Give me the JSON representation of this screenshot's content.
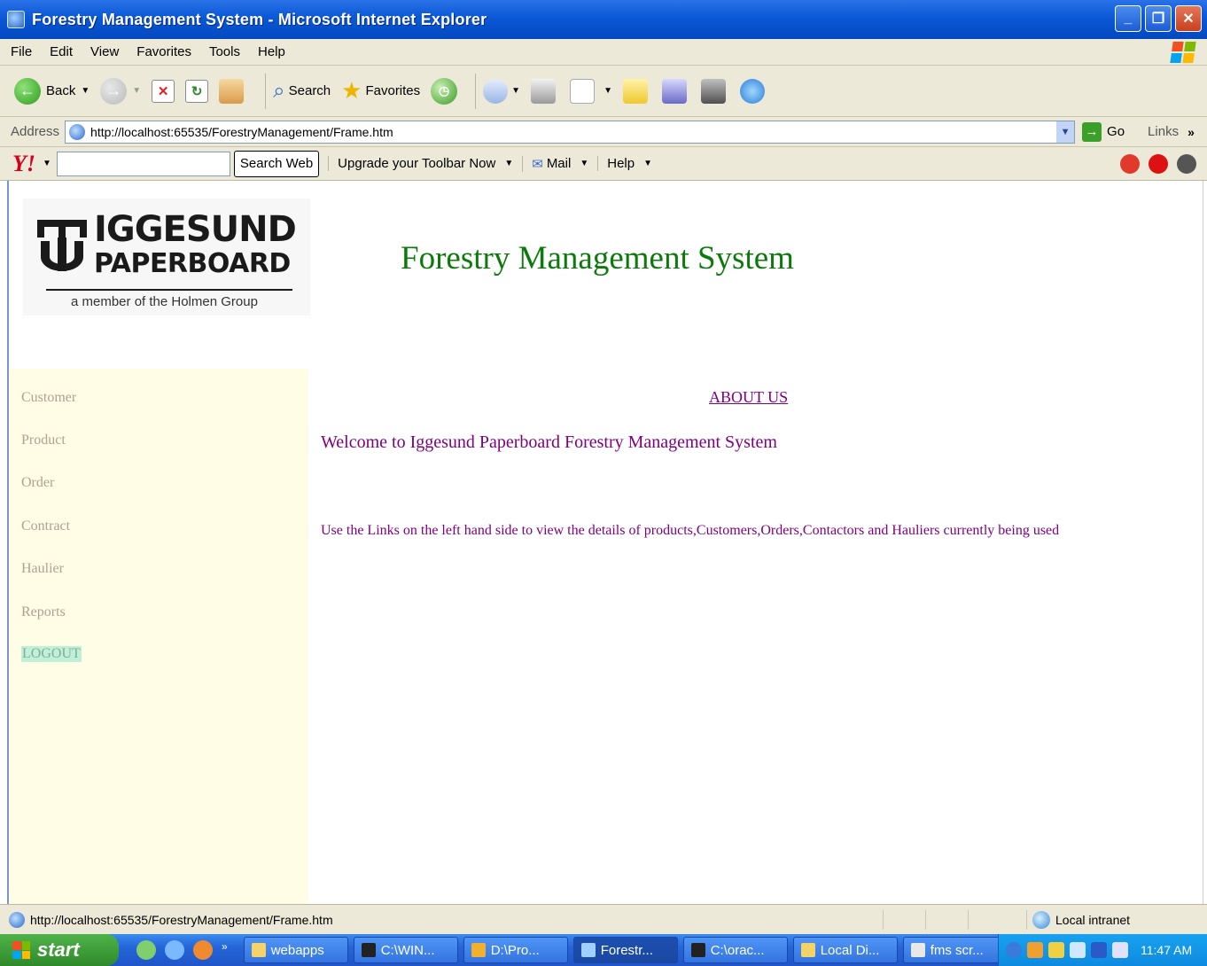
{
  "window": {
    "title": "Forestry Management System - Microsoft Internet Explorer",
    "controls": [
      "minimize",
      "restore",
      "close"
    ]
  },
  "menubar": {
    "items": [
      "File",
      "Edit",
      "View",
      "Favorites",
      "Tools",
      "Help"
    ]
  },
  "toolbar": {
    "back_label": "Back",
    "search_label": "Search",
    "favorites_label": "Favorites"
  },
  "addressbar": {
    "label": "Address",
    "url": "http://localhost:65535/ForestryManagement/Frame.htm",
    "go_label": "Go",
    "links_label": "Links"
  },
  "yahoo_toolbar": {
    "logo": "Y!",
    "search_button": "Search Web",
    "upgrade_label": "Upgrade your Toolbar Now",
    "mail_label": "Mail",
    "help_label": "Help"
  },
  "page": {
    "logo": {
      "line1": "IGGESUND",
      "line2": "PAPERBOARD",
      "tagline": "a member of the Holmen Group"
    },
    "title": "Forestry Management System",
    "nav": [
      "Customer",
      "Product",
      "Order",
      "Contract",
      "Haulier",
      "Reports",
      "LOGOUT"
    ],
    "about_link": "ABOUT US",
    "welcome": "Welcome to Iggesund Paperboard Forestry Management System",
    "instructions": "Use the Links on the left hand side to view the details of products,Customers,Orders,Contactors and Hauliers currently being used"
  },
  "statusbar": {
    "url": "http://localhost:65535/ForestryManagement/Frame.htm",
    "zone": "Local intranet"
  },
  "taskbar": {
    "start_label": "start",
    "tasks": [
      "webapps",
      "C:\\WIN...",
      "D:\\Pro...",
      "Forestr...",
      "C:\\orac...",
      "Local Di...",
      "fms scr..."
    ],
    "clock": "11:47 AM"
  },
  "colors": {
    "title_green": "#0b7a0b",
    "link_purple": "#800080",
    "sidebar_bg": "#fffde6",
    "logout_highlight": "#bff0d8"
  }
}
